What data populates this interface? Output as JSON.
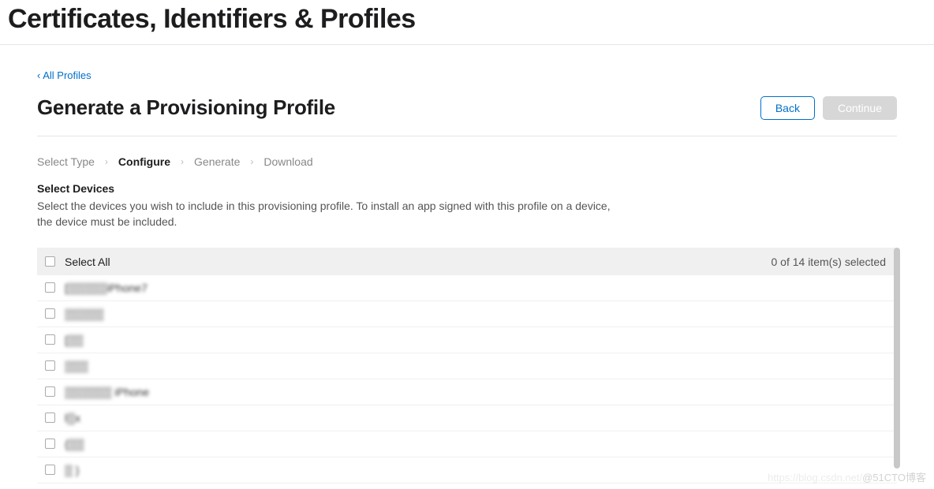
{
  "page_title": "Certificates, Identifiers & Profiles",
  "back_link": "‹ All Profiles",
  "heading": "Generate a Provisioning Profile",
  "buttons": {
    "back": "Back",
    "continue": "Continue"
  },
  "steps": [
    "Select Type",
    "Configure",
    "Generate",
    "Download"
  ],
  "active_step_index": 1,
  "devices": {
    "heading": "Select Devices",
    "description": "Select the devices you wish to include in this provisioning profile. To install an app signed with this profile on a device, the device must be included.",
    "select_all": "Select All",
    "selection_count": "0 of 14 item(s) selected",
    "rows": [
      "[▒▒▒▒▒iPhone7",
      "▒▒▒▒▒",
      "[▒▒",
      "▒▒▒",
      "▒▒▒▒▒▒ iPhone",
      "l▒x",
      "{▒▒",
      "▒ }"
    ]
  },
  "watermark_faint": "https://blog.csdn.net/",
  "watermark": "@51CTO博客"
}
